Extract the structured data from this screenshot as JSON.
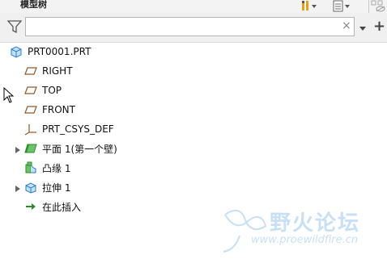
{
  "header": {
    "title": "模型树"
  },
  "filter": {
    "value": "",
    "placeholder": "",
    "clear_glyph": "×"
  },
  "tree": [
    {
      "label": "PRT0001.PRT",
      "icon": "part-icon",
      "expandable": false
    },
    {
      "label": "RIGHT",
      "icon": "datum-plane-icon",
      "expandable": false
    },
    {
      "label": "TOP",
      "icon": "datum-plane-icon",
      "expandable": false
    },
    {
      "label": "FRONT",
      "icon": "datum-plane-icon",
      "expandable": false
    },
    {
      "label": "PRT_CSYS_DEF",
      "icon": "csys-icon",
      "expandable": false
    },
    {
      "label": "平面 1(第一个壁)",
      "icon": "sheetmetal-plane-icon",
      "expandable": true
    },
    {
      "label": "凸缘 1",
      "icon": "flange-icon",
      "expandable": false
    },
    {
      "label": "拉伸 1",
      "icon": "extrude-icon",
      "expandable": true
    },
    {
      "label": "在此插入",
      "icon": "insert-here-icon",
      "expandable": false
    }
  ],
  "watermark": {
    "text": "野火论坛",
    "url": "www.proewildfire.cn"
  },
  "colors": {
    "accent": "#2e7bbf",
    "feature_green": "#3aa04a"
  }
}
